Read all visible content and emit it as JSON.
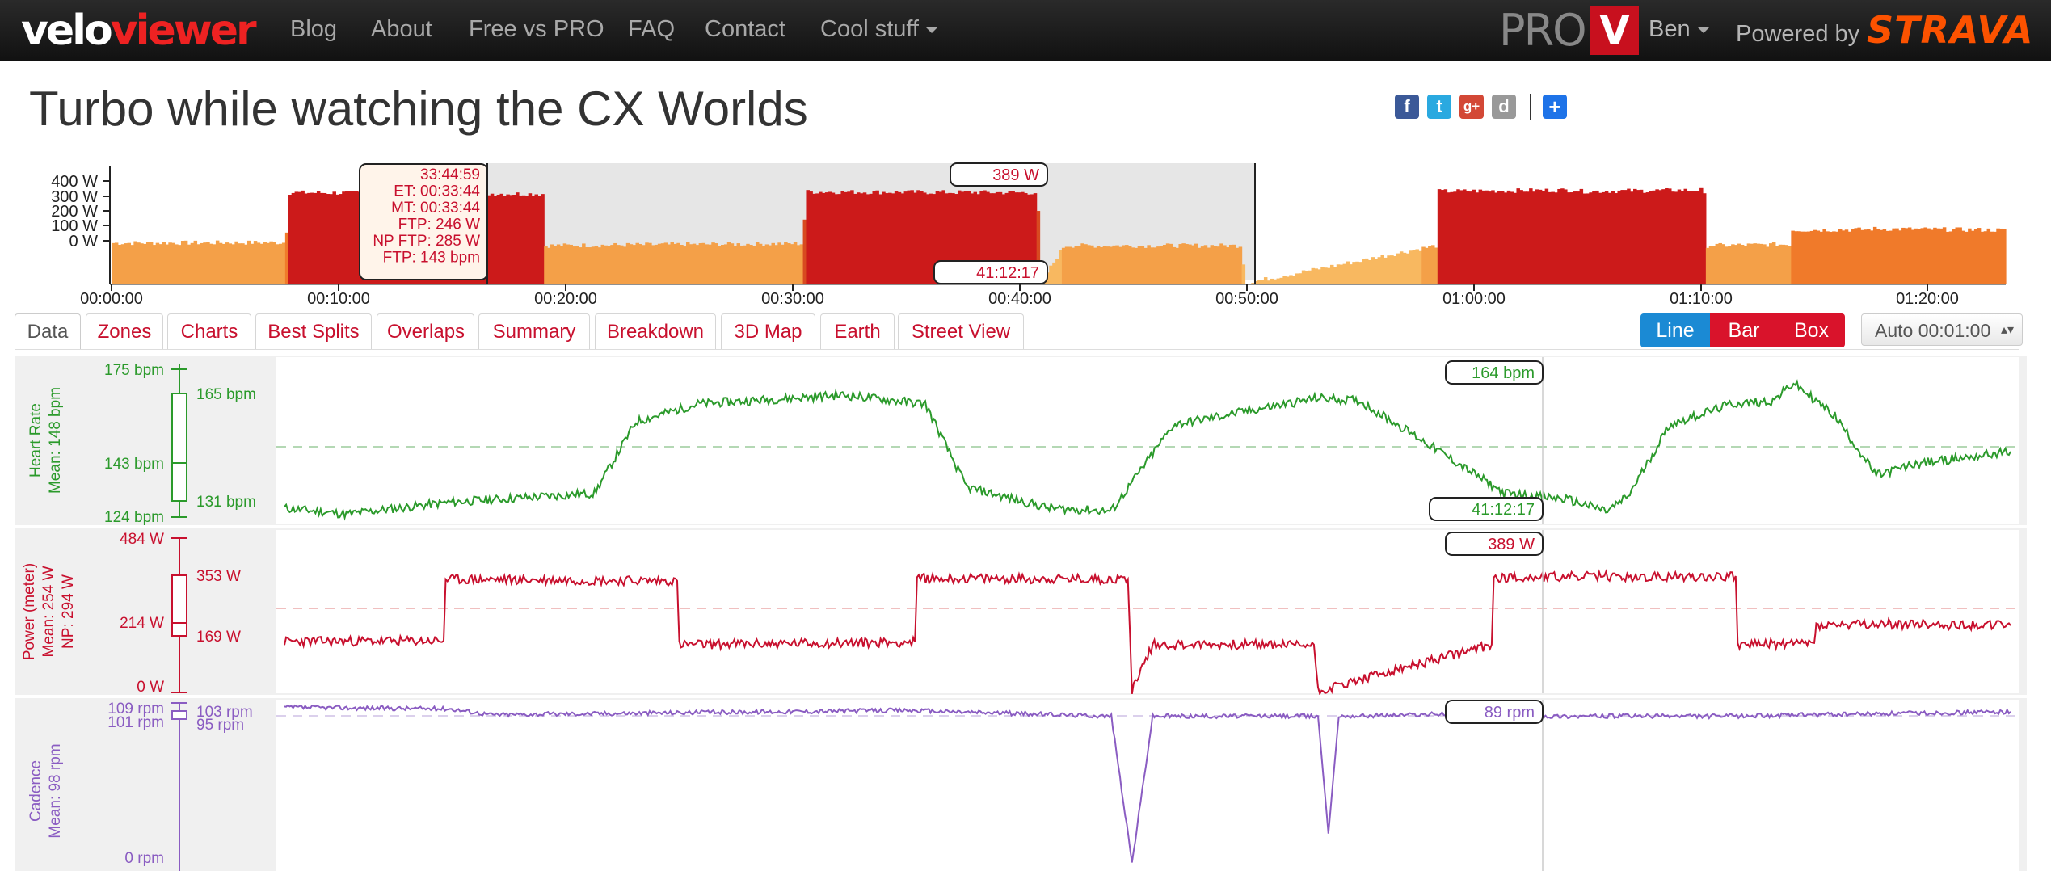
{
  "brand": {
    "part1": "velo",
    "part2": "viewer"
  },
  "nav": {
    "items": [
      "Blog",
      "About",
      "Free vs PRO",
      "FAQ",
      "Contact",
      "Cool stuff"
    ],
    "pro_label": "PRO",
    "user": "Ben",
    "powered_by": "Powered by",
    "strava": "STRAVA",
    "avatar_letter": "V"
  },
  "page_title": "Turbo while watching the CX Worlds",
  "share": {
    "icons": [
      "facebook-icon",
      "twitter-icon",
      "google-plus-icon",
      "delicious-icon",
      "addthis-icon"
    ],
    "glyphs": [
      "f",
      "t",
      "g+",
      "d",
      "+"
    ]
  },
  "overview": {
    "y_ticks": [
      "400 W",
      "300 W",
      "200 W",
      "100 W",
      "0 W"
    ],
    "x_ticks": [
      "00:00:00",
      "00:10:00",
      "00:20:00",
      "00:30:00",
      "00:40:00",
      "00:50:00",
      "01:00:00",
      "01:10:00",
      "01:20:00"
    ],
    "selection_stats": [
      "33:44:59",
      "ET: 00:33:44",
      "MT: 00:33:44",
      "FTP: 246 W",
      "NP FTP: 285 W",
      "FTP: 143 bpm"
    ],
    "hover_value": "389 W",
    "hover_time": "41:12:17"
  },
  "tabs": [
    "Data",
    "Zones",
    "Charts",
    "Best Splits",
    "Overlaps",
    "Summary",
    "Breakdown",
    "3D Map",
    "Earth",
    "Street View"
  ],
  "view_buttons": [
    "Line",
    "Bar",
    "Box"
  ],
  "smoothing": "Auto 00:01:00",
  "panels": {
    "heart_rate": {
      "title": "Heart Rate",
      "mean": "Mean: 148 bpm",
      "axis": [
        "175 bpm",
        "143 bpm",
        "124 bpm"
      ],
      "box": [
        "165 bpm",
        "131 bpm"
      ],
      "hover_value": "164 bpm",
      "hover_time": "41:12:17",
      "color": "#2b9a2b"
    },
    "power": {
      "title": "Power (meter)",
      "mean": "Mean: 254 W",
      "np": "NP: 294 W",
      "axis": [
        "484 W",
        "214 W",
        "0 W"
      ],
      "box": [
        "353 W",
        "169 W"
      ],
      "hover_value": "389 W",
      "color": "#c8102e"
    },
    "cadence": {
      "title": "Cadence",
      "mean": "Mean: 98 rpm",
      "axis": [
        "109 rpm",
        "101 rpm",
        "0 rpm"
      ],
      "box": [
        "103 rpm",
        "95 rpm"
      ],
      "hover_value": "89 rpm",
      "color": "#8a5cc2"
    }
  },
  "chart_data": {
    "type": "line",
    "x_unit": "time (minutes)",
    "xlim": [
      0,
      83.5
    ],
    "series": [
      {
        "name": "Heart Rate",
        "unit": "bpm",
        "ylim": [
          124,
          175
        ],
        "x": [
          0,
          3,
          8,
          15,
          17,
          20,
          27,
          31,
          33,
          37,
          40,
          43,
          50,
          52,
          55,
          59,
          62,
          64,
          65,
          67,
          70,
          72,
          73,
          75,
          77,
          79,
          83.5
        ],
        "values": [
          127,
          125,
          129,
          132,
          156,
          162,
          165,
          162,
          134,
          127,
          126,
          155,
          164,
          163,
          150,
          132,
          130,
          126,
          131,
          155,
          162,
          163,
          169,
          158,
          138,
          142,
          146
        ]
      },
      {
        "name": "Power (meter)",
        "unit": "W",
        "ylim": [
          0,
          484
        ],
        "x": [
          0,
          7.7,
          7.8,
          19,
          19.1,
          30.5,
          30.6,
          40.8,
          41,
          42,
          49.8,
          50,
          58.4,
          58.5,
          64.6,
          64.7,
          70.2,
          70.3,
          74,
          74.1,
          77.5,
          77.6,
          83.5
        ],
        "values": [
          160,
          162,
          355,
          350,
          150,
          158,
          358,
          355,
          10,
          150,
          150,
          5,
          150,
          360,
          365,
          360,
          365,
          150,
          155,
          210,
          212,
          215,
          210
        ]
      },
      {
        "name": "Cadence",
        "unit": "rpm",
        "ylim": [
          0,
          109
        ],
        "x": [
          0,
          8,
          10,
          30,
          40,
          41,
          42,
          50,
          50.5,
          51,
          58,
          60,
          70,
          83.5
        ],
        "values": [
          106,
          105,
          101,
          104,
          100,
          0,
          100,
          100,
          20,
          100,
          102,
          100,
          100,
          103
        ]
      }
    ]
  }
}
